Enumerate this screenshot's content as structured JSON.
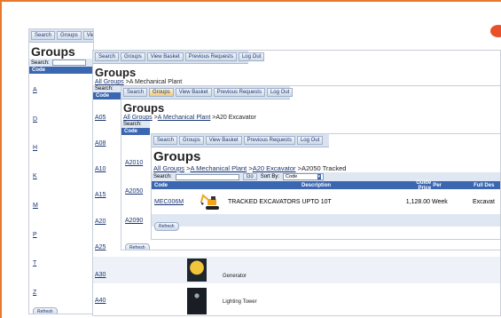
{
  "nav_labels": [
    "Search",
    "Groups",
    "View Basket",
    "Previous Requests",
    "Log Out"
  ],
  "win1": {
    "title": "Groups",
    "search_label": "Search:",
    "code_header": "Code",
    "letters": [
      "A",
      "D",
      "H",
      "K",
      "M",
      "P",
      "T",
      "Z"
    ],
    "refresh": "Refresh"
  },
  "win2": {
    "title": "Groups",
    "breadcrumb_root": "All Groups",
    "breadcrumb_rest": " >A Mechanical Plant",
    "search_label": "Search:",
    "code_header": "Code",
    "codes": [
      "A05",
      "A08",
      "A10",
      "A15",
      "A20",
      "A25",
      "A30",
      "A40"
    ],
    "rows": [
      {
        "code": "A30",
        "desc": "Generator"
      },
      {
        "code": "A40",
        "desc": "Lighting Tower"
      }
    ]
  },
  "win3": {
    "title": "Groups",
    "breadcrumb_root": "All Groups",
    "breadcrumb_mid": "A Mechanical Plant",
    "breadcrumb_rest": " >A20 Excavator",
    "search_label": "Search:",
    "code_header": "Code",
    "codes": [
      "A2010",
      "A2050",
      "A2090"
    ],
    "refresh": "Refresh"
  },
  "win4": {
    "title": "Groups",
    "breadcrumb_root": "All Groups",
    "breadcrumb_1": "A Mechanical Plant",
    "breadcrumb_2": "A20 Excavator",
    "breadcrumb_rest": " >A2050 Tracked",
    "search_label": "Search:",
    "go": "Go",
    "sort_label": "Sort By:",
    "sort_value": "Code",
    "columns": {
      "code": "Code",
      "description": "Description",
      "guide_price": "Guide Price",
      "per": "Per",
      "full_desc": "Full Des"
    },
    "item": {
      "code": "MEC006M",
      "description": "TRACKED EXCAVATORS UPTO 10T",
      "price": "1,128.00",
      "per": "Week",
      "full": "Excavat"
    },
    "refresh": "Refresh"
  },
  "colors": {
    "accent": "#e8782a",
    "header": "#3b66b0",
    "link": "#1a3570"
  }
}
